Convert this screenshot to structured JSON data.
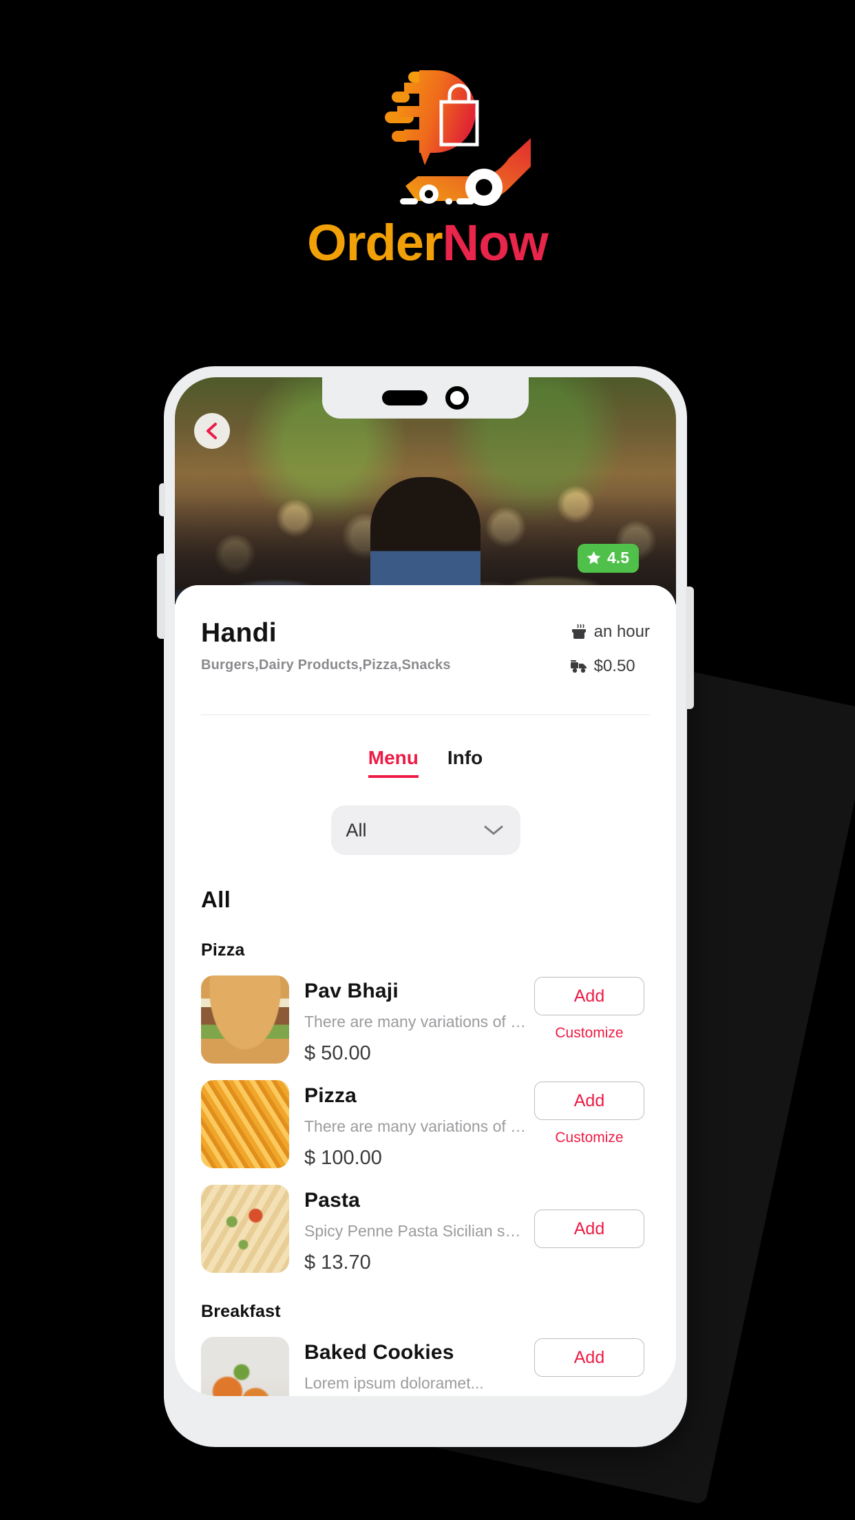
{
  "brand": {
    "name_part1": "Order",
    "name_part2": "Now",
    "color_part1": "#F2A007",
    "color_part2": "#E8254A",
    "logo_icon": "delivery-scooter-bag-logo"
  },
  "screen": {
    "back_icon": "chevron-left-icon",
    "rating": {
      "icon": "star-icon",
      "value": "4.5",
      "color": "#4FC14A"
    },
    "restaurant": {
      "name": "Handi",
      "tags": "Burgers,Dairy Products,Pizza,Snacks",
      "prep_time": {
        "icon": "cooking-pot-icon",
        "text": "an hour"
      },
      "delivery_fee": {
        "icon": "delivery-icon",
        "text": "$0.50"
      }
    },
    "tabs": [
      {
        "label": "Menu",
        "active": true
      },
      {
        "label": "Info",
        "active": false
      }
    ],
    "category_select": {
      "value": "All",
      "icon": "chevron-down-icon"
    },
    "section_title": "All",
    "accent_color": "#ED1B45",
    "categories": [
      {
        "title": "Pizza",
        "items": [
          {
            "name": "Pav Bhaji",
            "desc": "There are many variations of p...",
            "price": "$ 50.00",
            "add_label": "Add",
            "customize_label": "Customize",
            "thumb": "burger-photo"
          },
          {
            "name": "Pizza",
            "desc": "There are many variations of p...",
            "price": "$ 100.00",
            "add_label": "Add",
            "customize_label": "Customize",
            "thumb": "fries-photo"
          },
          {
            "name": "Pasta",
            "desc": "Spicy Penne Pasta Sicilian spic...",
            "price": "$ 13.70",
            "add_label": "Add",
            "customize_label": "",
            "thumb": "pasta-photo"
          }
        ]
      },
      {
        "title": "Breakfast",
        "items": [
          {
            "name": "Baked Cookies",
            "desc": "Lorem ipsum doloramet...",
            "price": "",
            "add_label": "Add",
            "customize_label": "",
            "thumb": "cookies-photo"
          }
        ]
      }
    ]
  }
}
